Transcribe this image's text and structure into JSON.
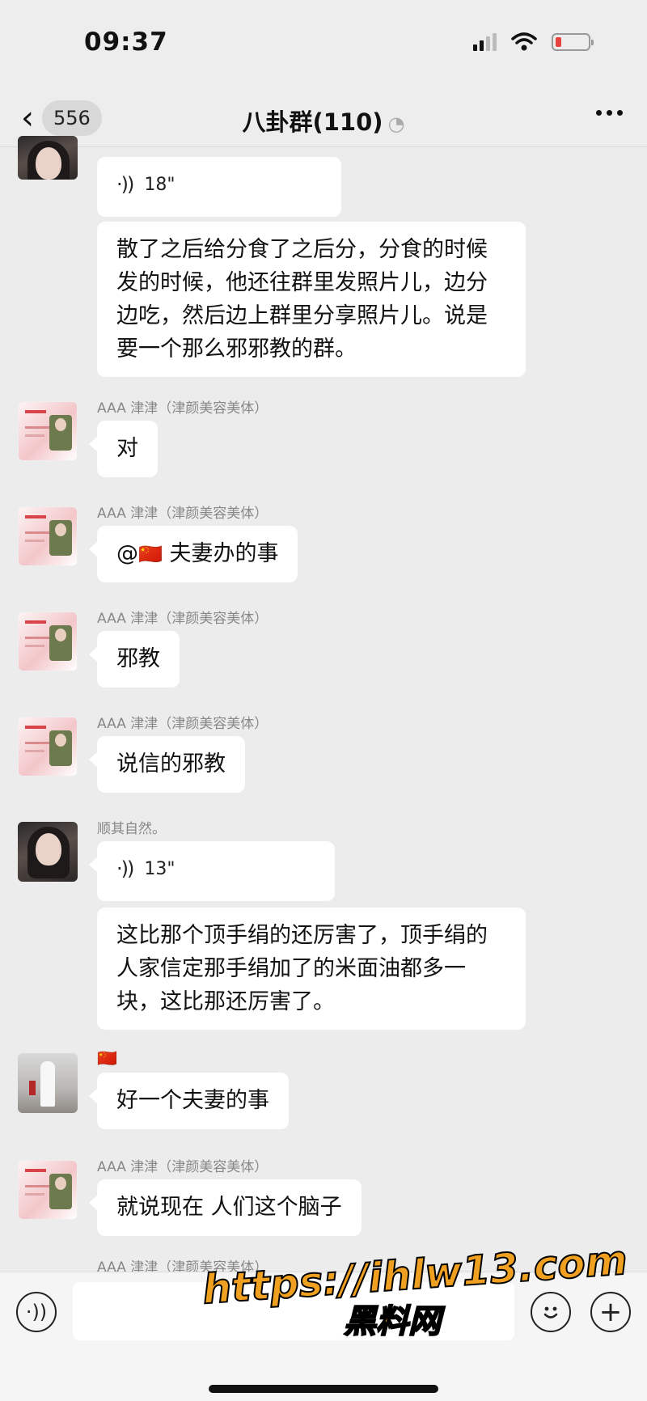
{
  "status_bar": {
    "time": "09:37"
  },
  "header": {
    "back_badge": "556",
    "title": "八卦群(110)"
  },
  "messages": {
    "m1": {
      "voice_duration": "18\""
    },
    "m2": {
      "text": "散了之后给分食了之后分，分食的时候发的时候，他还往群里发照片儿，边分边吃，然后边上群里分享照片儿。说是要一个那么邪邪教的群。"
    },
    "m3": {
      "sender": "AAA 津津（津颜美容美体）",
      "text": "对"
    },
    "m4": {
      "sender": "AAA 津津（津颜美容美体）",
      "mention": "@",
      "flag": "🇨🇳",
      "text": "夫妻办的事"
    },
    "m5": {
      "sender": "AAA 津津（津颜美容美体）",
      "text": "邪教"
    },
    "m6": {
      "sender": "AAA 津津（津颜美容美体）",
      "text": "说信的邪教"
    },
    "m7": {
      "sender": "顺其自然。",
      "voice_duration": "13\""
    },
    "m8": {
      "text": "这比那个顶手绢的还厉害了，顶手绢的人家信定那手绢加了的米面油都多一块，这比那还厉害了。"
    },
    "m9": {
      "sender": "🇨🇳",
      "text": "好一个夫妻的事"
    },
    "m10": {
      "sender": "AAA 津津（津颜美容美体）",
      "text": "就说现在 人们这个脑子"
    },
    "m11": {
      "sender": "AAA 津津（津颜美容美体）"
    }
  },
  "watermark": {
    "url": "https://ihlw13.com",
    "text": "黑料网"
  },
  "icons": {
    "back": "chevron-left-icon",
    "listen": "ear-icon",
    "more": "more-dots-icon",
    "voice_input": "voice-icon",
    "emoji": "emoji-icon",
    "plus": "plus-icon"
  },
  "colors": {
    "background": "#ececec",
    "bubble": "#ffffff",
    "battery_low": "#e8423f",
    "watermark": "#f0a020"
  }
}
